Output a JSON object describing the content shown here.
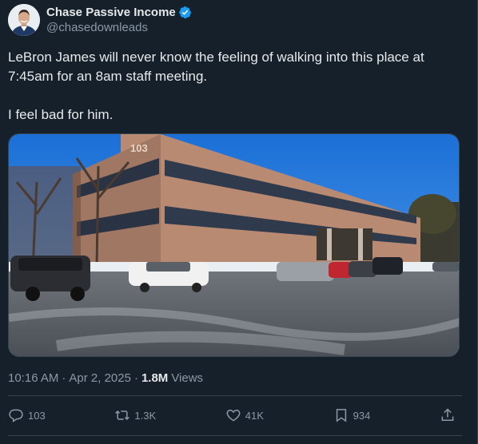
{
  "author": {
    "name": "Chase Passive Income",
    "handle": "@chasedownleads",
    "avatar_icon": "profile-photo",
    "verified_icon": "verified-badge-icon",
    "verified_color": "#1d9bf0"
  },
  "tweet": {
    "text": "LeBron James will never know the feeling of walking into this place at 7:45am for an 8am staff meeting.\n\nI feel bad for him.",
    "image_building_number": "103"
  },
  "meta": {
    "time": "10:16 AM",
    "separator": "·",
    "date": "Apr 2, 2025",
    "separator2": "·",
    "views_count": "1.8M",
    "views_label": "Views"
  },
  "actions": {
    "replies": "103",
    "reposts": "1.3K",
    "likes": "41K",
    "bookmarks": "934"
  },
  "colors": {
    "background": "#15202b",
    "text": "#e7e9ea",
    "secondary": "#8b98a5",
    "border": "#38444d"
  }
}
